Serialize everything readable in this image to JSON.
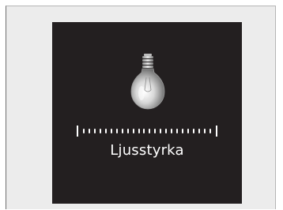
{
  "display": {
    "icon": "light-bulb-icon",
    "label": "Ljusstyrka",
    "brightness_level": 1.0,
    "tick_count": 24,
    "colors": {
      "screen_background": "#231f20",
      "foreground": "#ffffff",
      "frame_background": "#ececec"
    }
  }
}
